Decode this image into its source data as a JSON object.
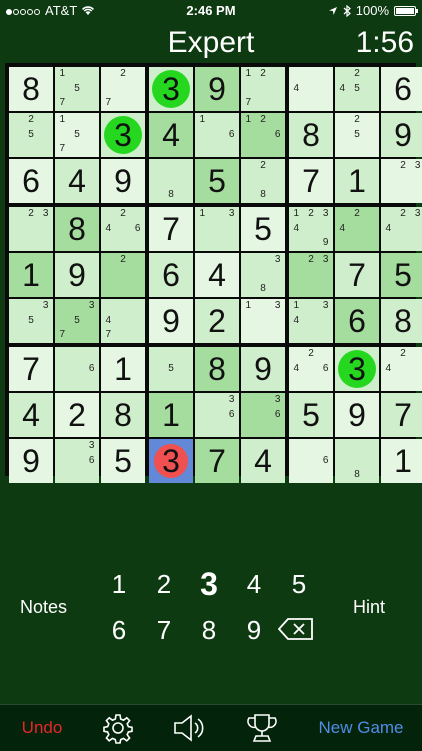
{
  "status": {
    "carrier": "AT&T",
    "time": "2:46 PM",
    "battery": "100%",
    "battery_level": 1.0,
    "signal_bars": 1,
    "signal_total": 5
  },
  "header": {
    "title": "Expert",
    "timer": "1:56"
  },
  "board": {
    "values": [
      [
        "8",
        "",
        "",
        "3",
        "9",
        "",
        "",
        "",
        "6"
      ],
      [
        "",
        "",
        "3",
        "4",
        "",
        "",
        "8",
        "",
        "9"
      ],
      [
        "6",
        "4",
        "9",
        "",
        "5",
        "",
        "7",
        "1",
        ""
      ],
      [
        "",
        "8",
        "",
        "7",
        "",
        "5",
        "",
        "",
        ""
      ],
      [
        "1",
        "9",
        "",
        "6",
        "4",
        "",
        "",
        "7",
        "5"
      ],
      [
        "",
        "",
        "",
        "9",
        "2",
        "",
        "",
        "6",
        "8"
      ],
      [
        "7",
        "",
        "1",
        "",
        "8",
        "9",
        "",
        "3",
        ""
      ],
      [
        "4",
        "2",
        "8",
        "1",
        "",
        "",
        "5",
        "9",
        "7"
      ],
      [
        "9",
        "",
        "5",
        "3",
        "7",
        "4",
        "",
        "",
        "1"
      ]
    ],
    "notes": [
      [
        [],
        [
          "1",
          "5",
          "7"
        ],
        [
          "2",
          "7"
        ],
        [],
        [],
        [
          "1",
          "2",
          "7"
        ],
        [
          "4"
        ],
        [
          "2",
          "4",
          "5"
        ],
        []
      ],
      [
        [
          "2",
          "5"
        ],
        [
          "1",
          "5",
          "7"
        ],
        [],
        [],
        [
          "1",
          "6"
        ],
        [
          "1",
          "2",
          "6"
        ],
        [],
        [
          "2",
          "5"
        ],
        []
      ],
      [
        [],
        [],
        [],
        [
          "8"
        ],
        [],
        [
          "2",
          "8"
        ],
        [],
        [],
        [
          "2",
          "3"
        ]
      ],
      [
        [
          "2",
          "3"
        ],
        [],
        [
          "2",
          "4",
          "6"
        ],
        [],
        [
          "1",
          "3"
        ],
        [],
        [
          "1",
          "2",
          "3",
          "4",
          "9"
        ],
        [
          "2",
          "4"
        ],
        [
          "2",
          "3",
          "4"
        ]
      ],
      [
        [],
        [],
        [
          "2"
        ],
        [],
        [],
        [
          "3",
          "8"
        ],
        [
          "2",
          "3"
        ],
        [],
        []
      ],
      [
        [
          "3",
          "5"
        ],
        [
          "3",
          "5",
          "7"
        ],
        [
          "4",
          "7"
        ],
        [],
        [],
        [
          "1",
          "3"
        ],
        [
          "1",
          "3",
          "4"
        ],
        [],
        []
      ],
      [
        [],
        [
          "6"
        ],
        [],
        [
          "5"
        ],
        [],
        [],
        [
          "2",
          "4",
          "6"
        ],
        [],
        [
          "2",
          "4"
        ]
      ],
      [
        [],
        [],
        [],
        [],
        [
          "3",
          "6"
        ],
        [
          "3",
          "6"
        ],
        [],
        [],
        []
      ],
      [
        [],
        [
          "3",
          "6"
        ],
        [],
        [],
        [],
        [],
        [
          "6"
        ],
        [
          "8"
        ],
        []
      ]
    ],
    "highlighted": [
      [
        0,
        3
      ],
      [
        1,
        2
      ],
      [
        6,
        7
      ]
    ],
    "selected": [
      8,
      3
    ],
    "conflict": [
      8,
      3
    ],
    "colors": {
      "light": "#e5f6e2",
      "mid": "#cfeecb",
      "dark": "#a5dd9e",
      "highlight": "#25d81f",
      "selected": "#6288d8",
      "conflict": "#f05050"
    }
  },
  "keypad": {
    "notes_label": "Notes",
    "hint_label": "Hint",
    "digits": [
      "1",
      "2",
      "3",
      "4",
      "5",
      "6",
      "7",
      "8",
      "9"
    ],
    "active_digit": "3",
    "erase_icon": "backspace-icon"
  },
  "toolbar": {
    "undo_label": "Undo",
    "settings_icon": "gear-icon",
    "sound_icon": "speaker-icon",
    "trophy_icon": "trophy-icon",
    "new_game_label": "New Game",
    "undo_color": "#e8262a",
    "new_game_color": "#4f8de8"
  }
}
